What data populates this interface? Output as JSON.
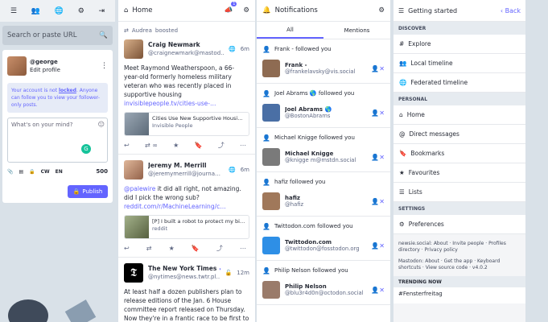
{
  "left": {
    "nav_icons": [
      "menu-icon",
      "people-icon",
      "globe-icon",
      "gear-icon",
      "logout-icon"
    ],
    "search_placeholder": "Search or paste URL",
    "account": {
      "handle": "@george",
      "edit": "Edit profile"
    },
    "notice": {
      "before": "Your account is not ",
      "link": "locked",
      "after": ". Anyone can follow you to view your follower-only posts."
    },
    "compose_placeholder": "What's on your mind?",
    "tools": {
      "cw": "CW",
      "lang": "EN",
      "count": "500"
    },
    "publish": "Publish"
  },
  "home": {
    "title": "Home",
    "badge": "1",
    "statuses": [
      {
        "boost": "Audrea",
        "boost_label": "boosted",
        "name": "Craig Newmark",
        "handle": "@craignewmark@mastod…",
        "time": "6m",
        "text": "Meet Raymond Weatherspoon, a 66-year-old formerly homeless military veteran who was recently placed in supportive housing",
        "link": "invisiblepeople.tv/cities-use-…",
        "card_title": "Cities Use New Supportive Housi…",
        "card_src": "Invisible People",
        "reblogs": "∞"
      },
      {
        "name": "Jeremy M. Merrill",
        "handle": "@jeremymerrill@journa…",
        "time": "6m",
        "mention": "@palewire",
        "text": " it did all right, not amazing. did I pick the wrong sub?",
        "link": "reddit.com/r/MachineLearning/c…",
        "card_title": "[P] I built a robot to protect my bi…",
        "card_src": "reddit"
      },
      {
        "name": "The New York Times",
        "handle": "@nytimes@news.twtr.pl…",
        "time": "12m",
        "text": "At least half a dozen publishers plan to release editions of the Jan. 6 House committee report released on Thursday. Now they're in a frantic race to be first to"
      }
    ]
  },
  "notifications": {
    "title": "Notifications",
    "tabs": [
      "All",
      "Mentions"
    ],
    "items": [
      {
        "title": "Frank - followed you",
        "name": "Frank -",
        "handle": "@frankelavsky@vis.social"
      },
      {
        "title": "Joel Abrams 🌎 followed you",
        "name": "Joel Abrams 🌎",
        "handle": "@BostonAbrams"
      },
      {
        "title": "Michael Knigge followed you",
        "name": "Michael Knigge",
        "handle": "@knigge m@mstdn.social"
      },
      {
        "title": "hafiz followed you",
        "name": "hafiz",
        "handle": "@hafiz"
      },
      {
        "title": "Twittodon.com followed you",
        "name": "Twittodon.com",
        "handle": "@twittodon@fosstodon.org"
      },
      {
        "title": "Philip Nelson followed you",
        "name": "Philip Nelson",
        "handle": "@blu3r4d0n@octodon.social"
      }
    ]
  },
  "getting_started": {
    "title": "Getting started",
    "back": "Back",
    "discover": "DISCOVER",
    "discover_items": [
      "Explore",
      "Local timeline",
      "Federated timeline"
    ],
    "personal": "PERSONAL",
    "personal_items": [
      "Home",
      "Direct messages",
      "Bookmarks",
      "Favourites",
      "Lists"
    ],
    "settings": "SETTINGS",
    "settings_items": [
      "Preferences"
    ],
    "footer1": "newsie.social: About · Invite people · Profiles directory · Privacy policy",
    "footer2": "Mastodon: About · Get the app · Keyboard shortcuts · View source code · v4.0.2",
    "trending": "TRENDING NOW",
    "trend_tag": "#Fensterfreitag"
  },
  "colors": {
    "accent": "#6364ff",
    "bg": "#d9e1e8"
  }
}
